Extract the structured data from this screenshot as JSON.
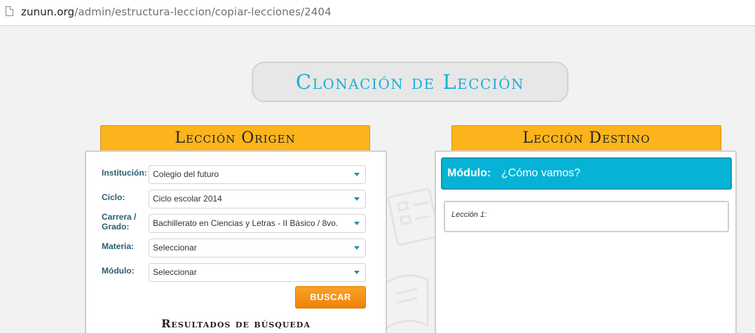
{
  "browser": {
    "url_host": "zunun.org",
    "url_path": "/admin/estructura-leccion/copiar-lecciones/2404"
  },
  "page": {
    "title": "Clonación de Lección"
  },
  "origin": {
    "tab_label": "Lección Origen",
    "fields": [
      {
        "label": "Institución:",
        "value": "Colegio del futuro"
      },
      {
        "label": "Ciclo:",
        "value": "Ciclo escolar 2014"
      },
      {
        "label": "Carrera / Grado:",
        "value": "Bachillerato en Ciencias y Letras - II Básico / 8vo."
      },
      {
        "label": "Materia:",
        "value": "Seleccionar"
      },
      {
        "label": "Módulo:",
        "value": "Seleccionar"
      }
    ],
    "search_button": "BUSCAR",
    "results_title": "Resultados de búsqueda"
  },
  "destination": {
    "tab_label": "Lección Destino",
    "module_label": "Módulo:",
    "module_value": "¿Cómo vamos?",
    "lesson_label": "Lección 1:"
  },
  "colors": {
    "accent_cyan": "#06b3d6",
    "tab_orange": "#fbb41c",
    "button_orange": "#f08105",
    "label_teal": "#2a5f74"
  }
}
